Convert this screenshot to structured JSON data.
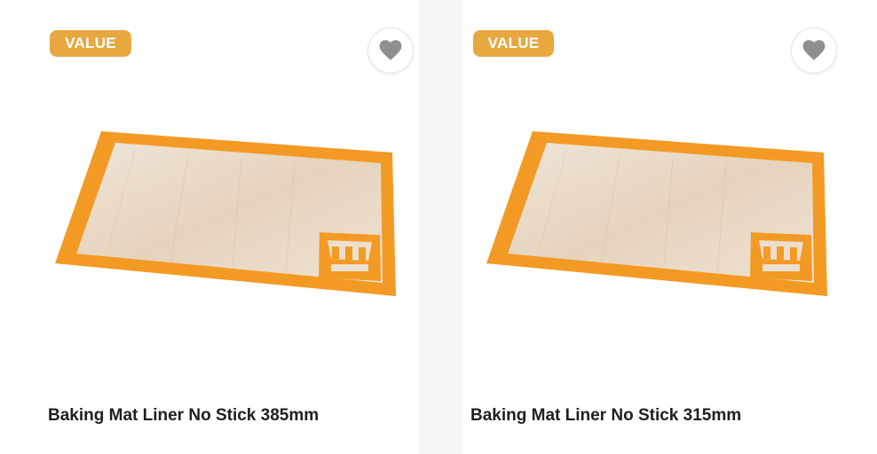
{
  "colors": {
    "badge_bg": "#e7a840",
    "mat_orange": "#f39a25",
    "mat_center": "#ecdfcf",
    "heart": "#8f8f8f"
  },
  "products": [
    {
      "badge": "VALUE",
      "title": "Baking Mat Liner No Stick 385mm",
      "image": "baking-mat-image",
      "wishlist_icon": "heart-icon"
    },
    {
      "badge": "VALUE",
      "title": "Baking Mat Liner No Stick 315mm",
      "image": "baking-mat-image",
      "wishlist_icon": "heart-icon"
    }
  ]
}
